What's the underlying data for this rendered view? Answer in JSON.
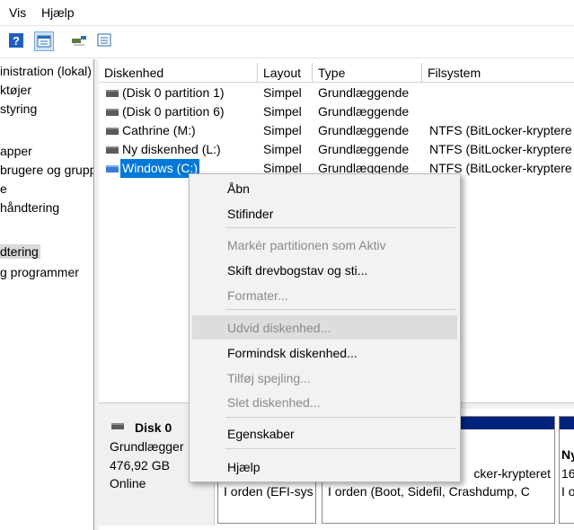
{
  "menubar": {
    "items": [
      "Vis",
      "Hjælp"
    ]
  },
  "toolbar": {
    "icons": [
      "help-icon",
      "properties-icon",
      "connect-icon",
      "list-icon"
    ]
  },
  "tree": {
    "items": [
      "inistration (lokal)",
      "ktøjer",
      "styring",
      "",
      "apper",
      "brugere og grupp",
      "e",
      "håndtering",
      "",
      "dtering",
      "g programmer"
    ],
    "selected_index": 9
  },
  "table": {
    "headers": [
      "Diskenhed",
      "Layout",
      "Type",
      "Filsystem"
    ],
    "rows": [
      {
        "volume": "(Disk 0 partition 1)",
        "layout": "Simpel",
        "type": "Grundlæggende",
        "fs": ""
      },
      {
        "volume": "(Disk 0 partition 6)",
        "layout": "Simpel",
        "type": "Grundlæggende",
        "fs": ""
      },
      {
        "volume": "Cathrine (M:)",
        "layout": "Simpel",
        "type": "Grundlæggende",
        "fs": "NTFS (BitLocker-kryptere"
      },
      {
        "volume": "Ny diskenhed (L:)",
        "layout": "Simpel",
        "type": "Grundlæggende",
        "fs": "NTFS (BitLocker-kryptere"
      },
      {
        "volume": "Windows (C:)",
        "layout": "Simpel",
        "type": "Grundlæggende",
        "fs": "NTFS (BitLocker-kryptere"
      }
    ],
    "selected_index": 4
  },
  "disk": {
    "name": "Disk 0",
    "type": "Grundlægger",
    "size": "476,92 GB",
    "status": "Online",
    "partitions": [
      {
        "line2": "I orden (EFI-sys"
      },
      {
        "line1": "cker-krypteret",
        "line2": "I orden (Boot, Sidefil, Crashdump, C"
      },
      {
        "line0": "Ny",
        "line1": "16",
        "line2": "I o"
      }
    ]
  },
  "context_menu": {
    "items": [
      {
        "label": "Åbn",
        "enabled": true
      },
      {
        "label": "Stifinder",
        "enabled": true
      },
      {
        "label": "Markér partitionen som Aktiv",
        "enabled": false
      },
      {
        "label": "Skift drevbogstav og sti...",
        "enabled": true
      },
      {
        "label": "Formater...",
        "enabled": false
      },
      {
        "label": "Udvid diskenhed...",
        "enabled": false
      },
      {
        "label": "Formindsk diskenhed...",
        "enabled": true
      },
      {
        "label": "Tilføj spejling...",
        "enabled": false
      },
      {
        "label": "Slet diskenhed...",
        "enabled": false
      },
      {
        "label": "Egenskaber",
        "enabled": true
      },
      {
        "label": "Hjælp",
        "enabled": true
      }
    ]
  },
  "colors": {
    "selection": "#0078d7",
    "partition_bar": "#00237d"
  }
}
